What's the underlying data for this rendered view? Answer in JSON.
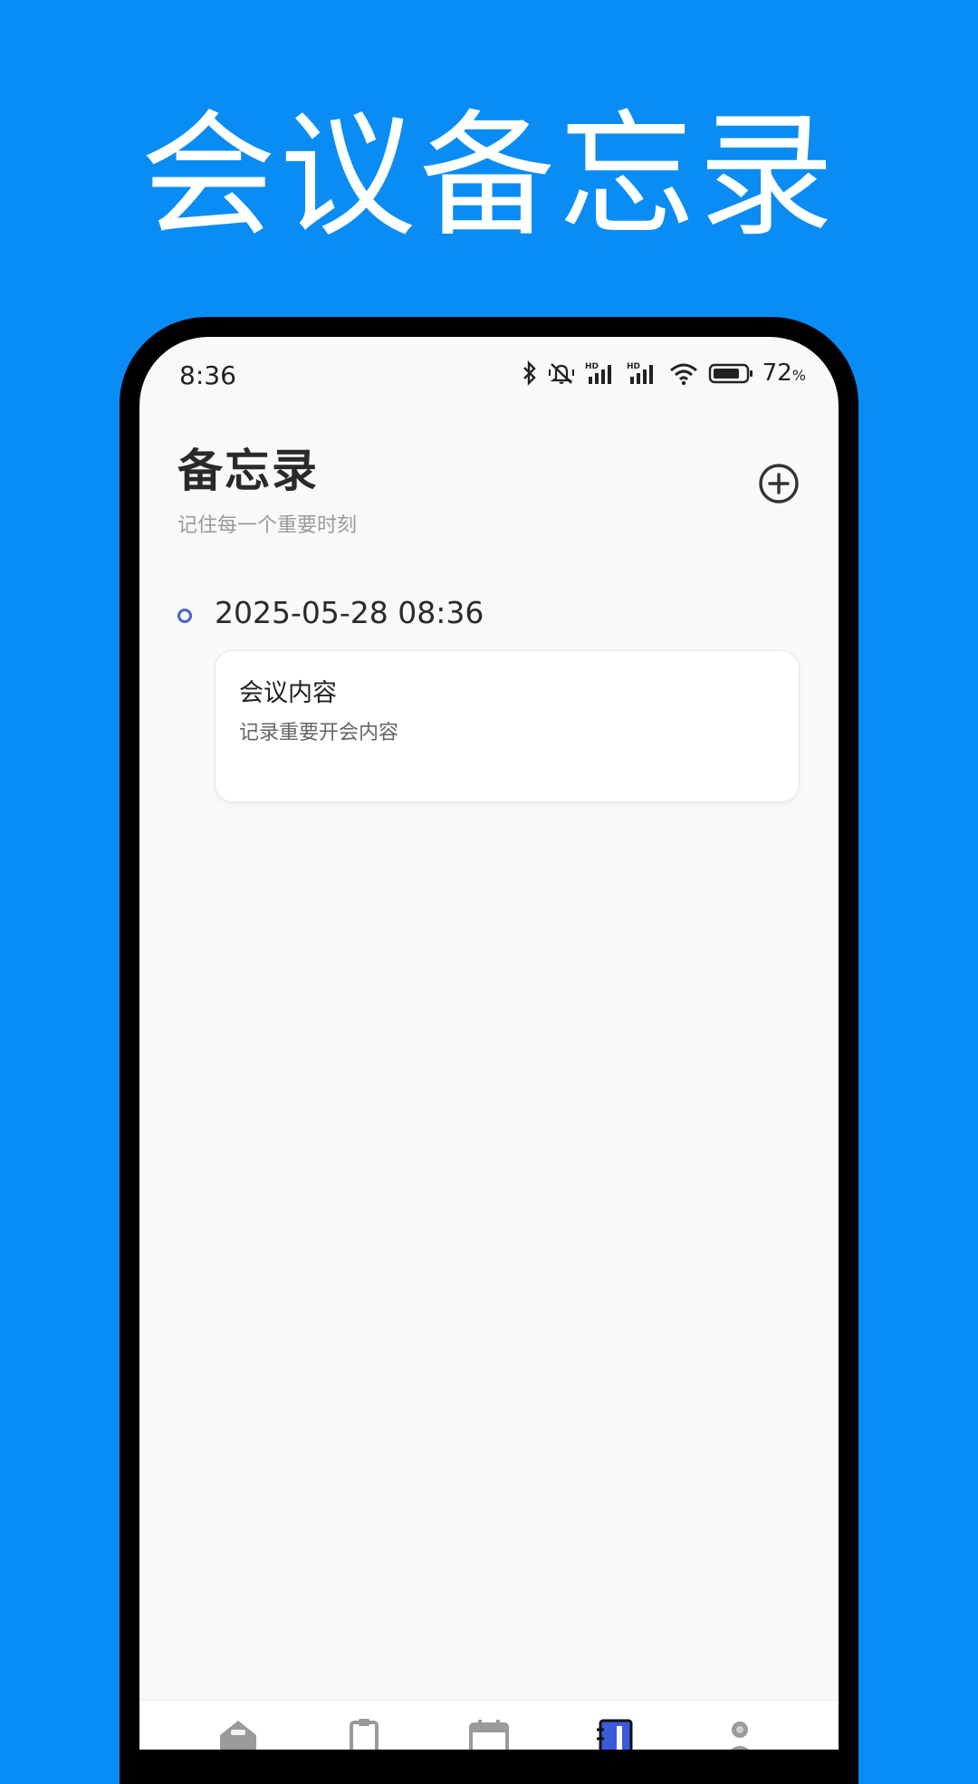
{
  "banner": {
    "title": "会议备忘录"
  },
  "status_bar": {
    "time": "8:36",
    "battery_percent": "72",
    "battery_unit": "%",
    "icons": [
      "bluetooth-icon",
      "mute-icon",
      "signal-hd-icon",
      "signal-hd-icon",
      "wifi-icon",
      "battery-icon"
    ]
  },
  "header": {
    "title": "备忘录",
    "subtitle": "记住每一个重要时刻",
    "add_icon": "plus-circle-icon"
  },
  "memos": [
    {
      "datetime": "2025-05-28 08:36",
      "title": "会议内容",
      "body": "记录重要开会内容"
    }
  ],
  "bottom_nav": {
    "items": [
      {
        "icon": "home-icon",
        "active": false
      },
      {
        "icon": "clipboard-icon",
        "active": false
      },
      {
        "icon": "calendar-icon",
        "active": false
      },
      {
        "icon": "notebook-icon",
        "active": true
      },
      {
        "icon": "profile-icon",
        "active": false
      }
    ],
    "active_color": "#3b5bdb",
    "inactive_color": "#9a9a9a"
  },
  "colors": {
    "background": "#0a8cf5",
    "screen": "#f7f9fb",
    "timeline_dot": "#4a63c7"
  }
}
